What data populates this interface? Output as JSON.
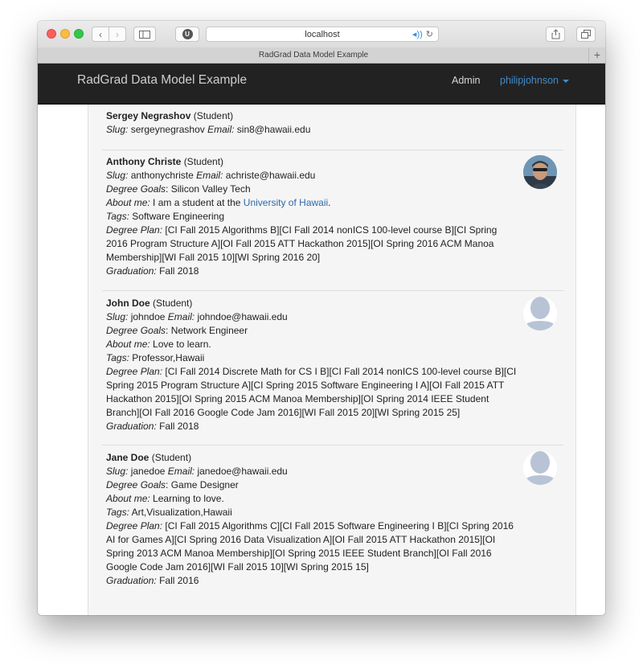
{
  "browser": {
    "address": "localhost",
    "tab_title": "RadGrad Data Model Example",
    "ext_letter": "U"
  },
  "navbar": {
    "brand": "RadGrad Data Model Example",
    "admin": "Admin",
    "user": "philipjohnson"
  },
  "students": [
    {
      "name": "Sergey Negrashov",
      "role": "(Student)",
      "slug_label": "Slug:",
      "slug": "sergeynegrashov",
      "email_label": "Email:",
      "email": "sin8@hawaii.edu"
    },
    {
      "name": "Anthony Christe",
      "role": "(Student)",
      "slug_label": "Slug:",
      "slug": "anthonychriste",
      "email_label": "Email:",
      "email": "achriste@hawaii.edu",
      "goals_label": "Degree Goals",
      "goals": ": Silicon Valley Tech",
      "about_label": "About me:",
      "about_text": "I am a student at the",
      "about_link": "University of Hawaii",
      "about_end": ".",
      "tags_label": "Tags:",
      "tags": "Software Engineering",
      "plan_label": "Degree Plan:",
      "plan_lines": [
        "[CI Fall 2015 Algorithms B][CI Fall 2014 nonICS 100-level course B][CI Spring",
        "2016 Program Structure A][OI Fall 2015 ATT Hackathon 2015][OI Spring 2016 ACM Manoa",
        "Membership][WI Fall 2015 10][WI Spring 2016 20]"
      ],
      "grad_label": "Graduation:",
      "grad": "Fall 2018"
    },
    {
      "name": "John Doe",
      "role": "(Student)",
      "slug_label": "Slug:",
      "slug": "johndoe",
      "email_label": "Email:",
      "email": "johndoe@hawaii.edu",
      "goals_label": "Degree Goals",
      "goals": ": Network Engineer",
      "about_label": "About me:",
      "about_text": "Love to learn.",
      "tags_label": "Tags:",
      "tags": "Professor,Hawaii",
      "plan_label": "Degree Plan:",
      "plan_lines": [
        "[CI Fall 2014 Discrete Math for CS I B][CI Fall 2014 nonICS 100-level course B][CI",
        "Spring 2015 Program Structure A][CI Spring 2015 Software Engineering I A][OI Fall 2015 ATT",
        "Hackathon 2015][OI Spring 2015 ACM Manoa Membership][OI Spring 2014 IEEE Student",
        "Branch][OI Fall 2016 Google Code Jam 2016][WI Fall 2015 20][WI Spring 2015 25]"
      ],
      "grad_label": "Graduation:",
      "grad": "Fall 2018"
    },
    {
      "name": "Jane Doe",
      "role": "(Student)",
      "slug_label": "Slug:",
      "slug": "janedoe",
      "email_label": "Email:",
      "email": "janedoe@hawaii.edu",
      "goals_label": "Degree Goals",
      "goals": ": Game Designer",
      "about_label": "About me:",
      "about_text": "Learning to love.",
      "tags_label": "Tags:",
      "tags": "Art,Visualization,Hawaii",
      "plan_label": "Degree Plan:",
      "plan_lines": [
        "[CI Fall 2015 Algorithms C][CI Fall 2015 Software Engineering I B][CI Spring 2016",
        "AI for Games A][CI Spring 2016 Data Visualization A][OI Fall 2015 ATT Hackathon 2015][OI",
        "Spring 2013 ACM Manoa Membership][OI Spring 2015 IEEE Student Branch][OI Fall 2016",
        "Google Code Jam 2016][WI Fall 2015 10][WI Spring 2015 15]"
      ],
      "grad_label": "Graduation:",
      "grad": "Fall 2016"
    }
  ]
}
